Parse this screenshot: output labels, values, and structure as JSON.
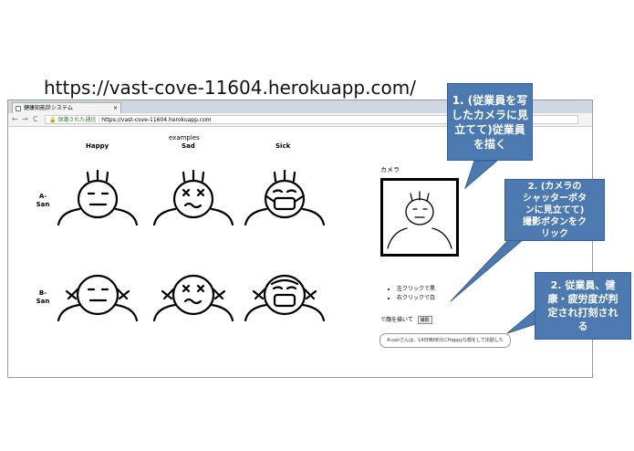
{
  "url_heading": "https://vast-cove-11604.herokuapp.com/",
  "browser": {
    "tab_title": "健康知能診システム",
    "nav": {
      "back": "←",
      "forward": "→",
      "reload": "C",
      "tab_close": "×"
    },
    "secure_label": "保護された通信",
    "address": "https://vast-cove-11604.herokuapp.com"
  },
  "page": {
    "examples_label": "examples",
    "columns": [
      "Happy",
      "Sad",
      "Sick"
    ],
    "rows": [
      {
        "label_line1": "A-",
        "label_line2": "San"
      },
      {
        "label_line1": "B-",
        "label_line2": "San"
      }
    ],
    "camera_label": "カメラ",
    "instructions": [
      "左クリックで黒",
      "右クリックで白"
    ],
    "draw_prompt": "で顔を描いて",
    "shoot_button": "撮影",
    "result_text": "A-sanさんは、14日時08分にHappyな顔をして出勤した"
  },
  "callouts": {
    "c1": [
      "1. (従業員を写",
      "したカメラに見",
      "立てて)従業員",
      "を描く"
    ],
    "c2": [
      "2. (カメラの",
      "シャッターボタ",
      "ンに見立てて)",
      "撮影ボタンをク",
      "リック"
    ],
    "c3": [
      "2. 従業員、健",
      "康・疲労度が判",
      "定され打刻され",
      "る"
    ]
  },
  "colors": {
    "callout_bg": "#4c7ab0",
    "secure_text": "#2f7d32"
  }
}
